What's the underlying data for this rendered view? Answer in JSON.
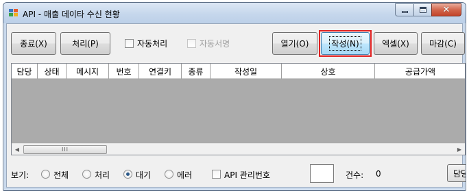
{
  "window": {
    "title": "API - 매출 데이타 수신 현황"
  },
  "toolbar": {
    "close_label": "종료(X)",
    "process_label": "처리(P)",
    "auto_process_label": "자동처리",
    "auto_sign_label": "자동서명",
    "open_label": "열기(O)",
    "write_label": "작성(N)",
    "excel_label": "엑셀(X)",
    "deadline_label": "마감(C)"
  },
  "grid": {
    "columns": [
      "담당",
      "상태",
      "메시지",
      "번호",
      "연결키",
      "종류",
      "작성일",
      "상호",
      "공급가액"
    ],
    "rows": [],
    "scroll_thumb_text": "III",
    "scroll_left": "◀",
    "scroll_right": "▶"
  },
  "filter": {
    "view_label": "보기:",
    "options": [
      "전체",
      "처리",
      "대기",
      "에러"
    ],
    "selected": "대기",
    "api_mgmt_label": "API 관리번호",
    "api_mgmt_value": "",
    "count_label": "건수:",
    "count_value": "0",
    "partial_button_label": "담당"
  },
  "colors": {
    "highlight": "#e02020",
    "title_bar": "#c6d7ec",
    "grid_body": "#ababab",
    "close_button": "#d2654b"
  },
  "icons": {
    "app": "app-icon",
    "minimize": "minimize-icon",
    "maximize": "maximize-icon",
    "close": "close-icon"
  }
}
